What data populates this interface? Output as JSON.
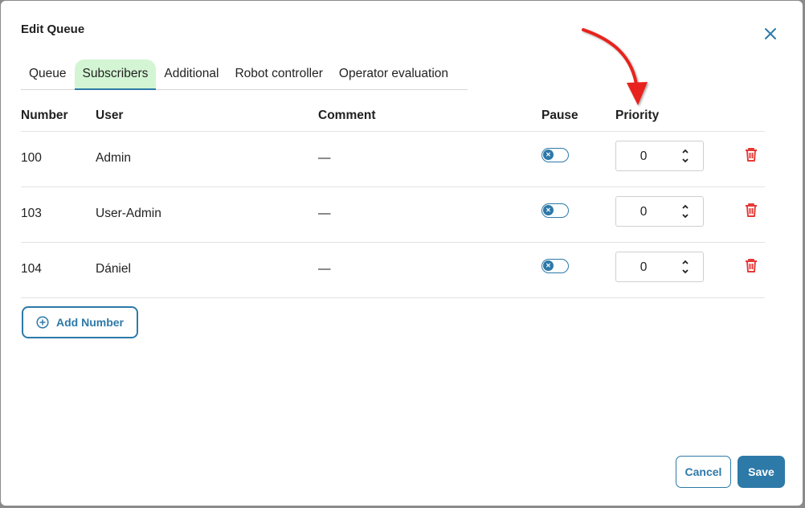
{
  "dialog": {
    "title": "Edit Queue",
    "close_icon": "close-icon"
  },
  "tabs": [
    {
      "label": "Queue",
      "active": false
    },
    {
      "label": "Subscribers",
      "active": true
    },
    {
      "label": "Additional",
      "active": false
    },
    {
      "label": "Robot controller",
      "active": false
    },
    {
      "label": "Operator evaluation",
      "active": false
    }
  ],
  "table": {
    "headers": {
      "number": "Number",
      "user": "User",
      "comment": "Comment",
      "pause": "Pause",
      "priority": "Priority"
    },
    "rows": [
      {
        "number": "100",
        "user": "Admin",
        "comment": "—",
        "pause": false,
        "priority": "0"
      },
      {
        "number": "103",
        "user": "User-Admin",
        "comment": "—",
        "pause": false,
        "priority": "0"
      },
      {
        "number": "104",
        "user": "Dániel",
        "comment": "—",
        "pause": false,
        "priority": "0"
      }
    ]
  },
  "actions": {
    "add_number_label": "Add Number",
    "cancel_label": "Cancel",
    "save_label": "Save"
  },
  "colors": {
    "accent": "#2d79a8",
    "active_tab_bg": "#d3f5d3",
    "delete": "#e53935",
    "annotation_arrow": "#e8231a"
  }
}
